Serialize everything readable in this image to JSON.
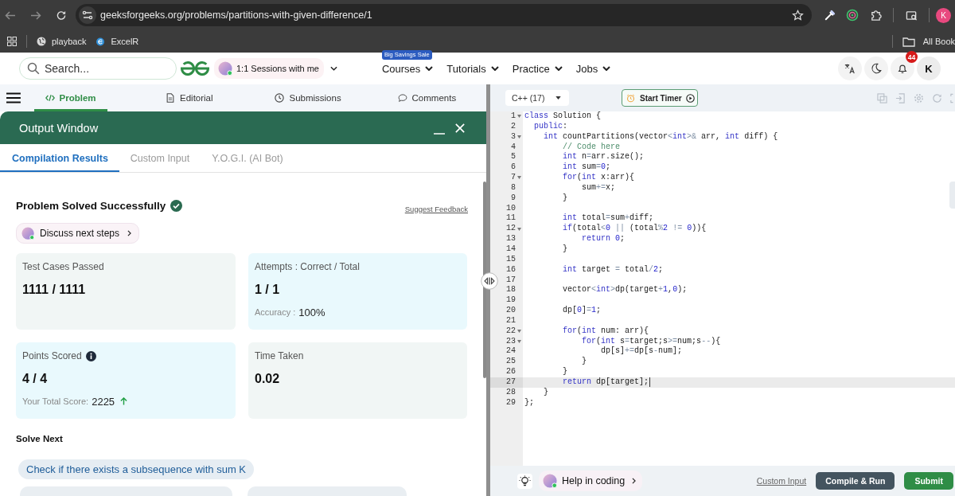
{
  "browser": {
    "url": "geeksforgeeks.org/problems/partitions-with-given-difference/1",
    "profile_initial": "K",
    "bookmarks": [
      {
        "label": "playback"
      },
      {
        "label": "ExcelR"
      }
    ],
    "all_bookmarks": "All Book"
  },
  "header": {
    "search": {
      "placeholder": "Search..."
    },
    "sessions": "1:1 Sessions with me",
    "nav": [
      {
        "label": "Courses",
        "badge": "Big Savings Sale"
      },
      {
        "label": "Tutorials"
      },
      {
        "label": "Practice"
      },
      {
        "label": "Jobs"
      }
    ],
    "notifications": "44",
    "avatar": "K"
  },
  "problem_tabs": [
    {
      "label": "Problem",
      "selected": true
    },
    {
      "label": "Editorial",
      "selected": false
    },
    {
      "label": "Submissions",
      "selected": false
    },
    {
      "label": "Comments",
      "selected": false
    }
  ],
  "output_window": {
    "title": "Output Window",
    "tabs": [
      {
        "label": "Compilation Results",
        "selected": true
      },
      {
        "label": "Custom Input",
        "selected": false
      },
      {
        "label": "Y.O.G.I. (AI Bot)",
        "selected": false
      }
    ],
    "status": "Problem Solved Successfully",
    "solved": true,
    "feedback_link": "Suggest Feedback",
    "discuss": "Discuss next steps",
    "cards": [
      {
        "label": "Test Cases Passed",
        "info": false,
        "value": "1111 / 1111"
      },
      {
        "label": "Attempts : Correct / Total",
        "info": false,
        "value": "1 / 1",
        "note_label": "Accuracy :",
        "note_value": "100%",
        "rising": false
      },
      {
        "label": "Points Scored",
        "info": true,
        "value": "4 / 4",
        "note_label": "Your Total Score:",
        "note_value": "2225",
        "rising": true
      },
      {
        "label": "Time Taken",
        "info": false,
        "value": "0.02"
      }
    ],
    "solve_next": {
      "title": "Solve Next",
      "items": [
        {
          "label": "Check if there exists a subsequence with sum K"
        }
      ]
    }
  },
  "editor": {
    "language": "C++ (17)",
    "timer": "Start Timer",
    "lines": [
      {
        "number": "1",
        "foldable": true,
        "current": false,
        "tokens": [
          {
            "kind": "keyword",
            "text": "class"
          },
          {
            "kind": "plain",
            "text": " Solution {"
          }
        ]
      },
      {
        "number": "2",
        "foldable": false,
        "current": false,
        "tokens": [
          {
            "kind": "keyword",
            "text": "  public"
          },
          {
            "kind": "plain",
            "text": ":"
          }
        ]
      },
      {
        "number": "3",
        "foldable": true,
        "current": false,
        "tokens": [
          {
            "kind": "keyword",
            "text": "    int"
          },
          {
            "kind": "plain",
            "text": " countPartitions(vector"
          },
          {
            "kind": "operator",
            "text": "<"
          },
          {
            "kind": "keyword",
            "text": "int"
          },
          {
            "kind": "operator",
            "text": ">&"
          },
          {
            "kind": "plain",
            "text": " arr, "
          },
          {
            "kind": "keyword",
            "text": "int"
          },
          {
            "kind": "plain",
            "text": " diff) {"
          }
        ]
      },
      {
        "number": "4",
        "foldable": false,
        "current": false,
        "tokens": [
          {
            "kind": "comment",
            "text": "        // Code here"
          }
        ]
      },
      {
        "number": "5",
        "foldable": false,
        "current": false,
        "tokens": [
          {
            "kind": "keyword",
            "text": "        int"
          },
          {
            "kind": "plain",
            "text": " n"
          },
          {
            "kind": "operator",
            "text": "="
          },
          {
            "kind": "plain",
            "text": "arr.size();"
          }
        ]
      },
      {
        "number": "6",
        "foldable": false,
        "current": false,
        "tokens": [
          {
            "kind": "keyword",
            "text": "        int"
          },
          {
            "kind": "plain",
            "text": " sum"
          },
          {
            "kind": "operator",
            "text": "="
          },
          {
            "kind": "number",
            "text": "0"
          },
          {
            "kind": "plain",
            "text": ";"
          }
        ]
      },
      {
        "number": "7",
        "foldable": true,
        "current": false,
        "tokens": [
          {
            "kind": "keyword",
            "text": "        for"
          },
          {
            "kind": "plain",
            "text": "("
          },
          {
            "kind": "keyword",
            "text": "int"
          },
          {
            "kind": "plain",
            "text": " x:arr){"
          }
        ]
      },
      {
        "number": "8",
        "foldable": false,
        "current": false,
        "tokens": [
          {
            "kind": "plain",
            "text": "            sum"
          },
          {
            "kind": "operator",
            "text": "+="
          },
          {
            "kind": "plain",
            "text": "x;"
          }
        ]
      },
      {
        "number": "9",
        "foldable": false,
        "current": false,
        "tokens": [
          {
            "kind": "plain",
            "text": "        }"
          }
        ]
      },
      {
        "number": "10",
        "foldable": false,
        "current": false
      },
      {
        "number": "11",
        "foldable": false,
        "current": false,
        "tokens": [
          {
            "kind": "keyword",
            "text": "        int"
          },
          {
            "kind": "plain",
            "text": " total"
          },
          {
            "kind": "operator",
            "text": "="
          },
          {
            "kind": "plain",
            "text": "sum"
          },
          {
            "kind": "operator",
            "text": "+"
          },
          {
            "kind": "plain",
            "text": "diff;"
          }
        ]
      },
      {
        "number": "12",
        "foldable": true,
        "current": false,
        "tokens": [
          {
            "kind": "keyword",
            "text": "        if"
          },
          {
            "kind": "plain",
            "text": "(total"
          },
          {
            "kind": "operator",
            "text": "<"
          },
          {
            "kind": "number",
            "text": "0"
          },
          {
            "kind": "operator",
            "text": " || "
          },
          {
            "kind": "plain",
            "text": "(total"
          },
          {
            "kind": "operator",
            "text": "%"
          },
          {
            "kind": "number",
            "text": "2"
          },
          {
            "kind": "operator",
            "text": " != "
          },
          {
            "kind": "number",
            "text": "0"
          },
          {
            "kind": "plain",
            "text": ")){"
          }
        ]
      },
      {
        "number": "13",
        "foldable": false,
        "current": false,
        "tokens": [
          {
            "kind": "keyword",
            "text": "            return"
          },
          {
            "kind": "number",
            "text": " 0"
          },
          {
            "kind": "plain",
            "text": ";"
          }
        ]
      },
      {
        "number": "14",
        "foldable": false,
        "current": false,
        "tokens": [
          {
            "kind": "plain",
            "text": "        }"
          }
        ]
      },
      {
        "number": "15",
        "foldable": false,
        "current": false
      },
      {
        "number": "16",
        "foldable": false,
        "current": false,
        "tokens": [
          {
            "kind": "keyword",
            "text": "        int"
          },
          {
            "kind": "plain",
            "text": " target "
          },
          {
            "kind": "operator",
            "text": "="
          },
          {
            "kind": "plain",
            "text": " total"
          },
          {
            "kind": "operator",
            "text": "/"
          },
          {
            "kind": "number",
            "text": "2"
          },
          {
            "kind": "plain",
            "text": ";"
          }
        ]
      },
      {
        "number": "17",
        "foldable": false,
        "current": false
      },
      {
        "number": "18",
        "foldable": false,
        "current": false,
        "tokens": [
          {
            "kind": "plain",
            "text": "        vector"
          },
          {
            "kind": "operator",
            "text": "<"
          },
          {
            "kind": "keyword",
            "text": "int"
          },
          {
            "kind": "operator",
            "text": ">"
          },
          {
            "kind": "plain",
            "text": "dp(target"
          },
          {
            "kind": "operator",
            "text": "+"
          },
          {
            "kind": "number",
            "text": "1"
          },
          {
            "kind": "plain",
            "text": ","
          },
          {
            "kind": "number",
            "text": "0"
          },
          {
            "kind": "plain",
            "text": ");"
          }
        ]
      },
      {
        "number": "19",
        "foldable": false,
        "current": false
      },
      {
        "number": "20",
        "foldable": false,
        "current": false,
        "tokens": [
          {
            "kind": "plain",
            "text": "        dp["
          },
          {
            "kind": "number",
            "text": "0"
          },
          {
            "kind": "plain",
            "text": "]"
          },
          {
            "kind": "operator",
            "text": "="
          },
          {
            "kind": "number",
            "text": "1"
          },
          {
            "kind": "plain",
            "text": ";"
          }
        ]
      },
      {
        "number": "21",
        "foldable": false,
        "current": false
      },
      {
        "number": "22",
        "foldable": true,
        "current": false,
        "tokens": [
          {
            "kind": "keyword",
            "text": "        for"
          },
          {
            "kind": "plain",
            "text": "("
          },
          {
            "kind": "keyword",
            "text": "int"
          },
          {
            "kind": "plain",
            "text": " num: arr){"
          }
        ]
      },
      {
        "number": "23",
        "foldable": true,
        "current": false,
        "tokens": [
          {
            "kind": "keyword",
            "text": "            for"
          },
          {
            "kind": "plain",
            "text": "("
          },
          {
            "kind": "keyword",
            "text": "int"
          },
          {
            "kind": "plain",
            "text": " s"
          },
          {
            "kind": "operator",
            "text": "="
          },
          {
            "kind": "plain",
            "text": "target;s"
          },
          {
            "kind": "operator",
            "text": ">="
          },
          {
            "kind": "plain",
            "text": "num;s"
          },
          {
            "kind": "operator",
            "text": "--"
          },
          {
            "kind": "plain",
            "text": "){"
          }
        ]
      },
      {
        "number": "24",
        "foldable": false,
        "current": false,
        "tokens": [
          {
            "kind": "plain",
            "text": "                dp[s]"
          },
          {
            "kind": "operator",
            "text": "+="
          },
          {
            "kind": "plain",
            "text": "dp[s"
          },
          {
            "kind": "operator",
            "text": "-"
          },
          {
            "kind": "plain",
            "text": "num];"
          }
        ]
      },
      {
        "number": "25",
        "foldable": false,
        "current": false,
        "tokens": [
          {
            "kind": "plain",
            "text": "            }"
          }
        ]
      },
      {
        "number": "26",
        "foldable": false,
        "current": false,
        "tokens": [
          {
            "kind": "plain",
            "text": "        }"
          }
        ]
      },
      {
        "number": "27",
        "foldable": false,
        "current": true,
        "tokens": [
          {
            "kind": "keyword",
            "text": "        return"
          },
          {
            "kind": "plain",
            "text": " dp[target];"
          }
        ]
      },
      {
        "number": "28",
        "foldable": false,
        "current": false,
        "tokens": [
          {
            "kind": "plain",
            "text": "    }"
          }
        ]
      },
      {
        "number": "29",
        "foldable": false,
        "current": false,
        "tokens": [
          {
            "kind": "plain",
            "text": "};"
          }
        ]
      }
    ],
    "help": "Help in coding",
    "custom_input": "Custom Input",
    "compile": "Compile & Run",
    "submit": "Submit"
  }
}
